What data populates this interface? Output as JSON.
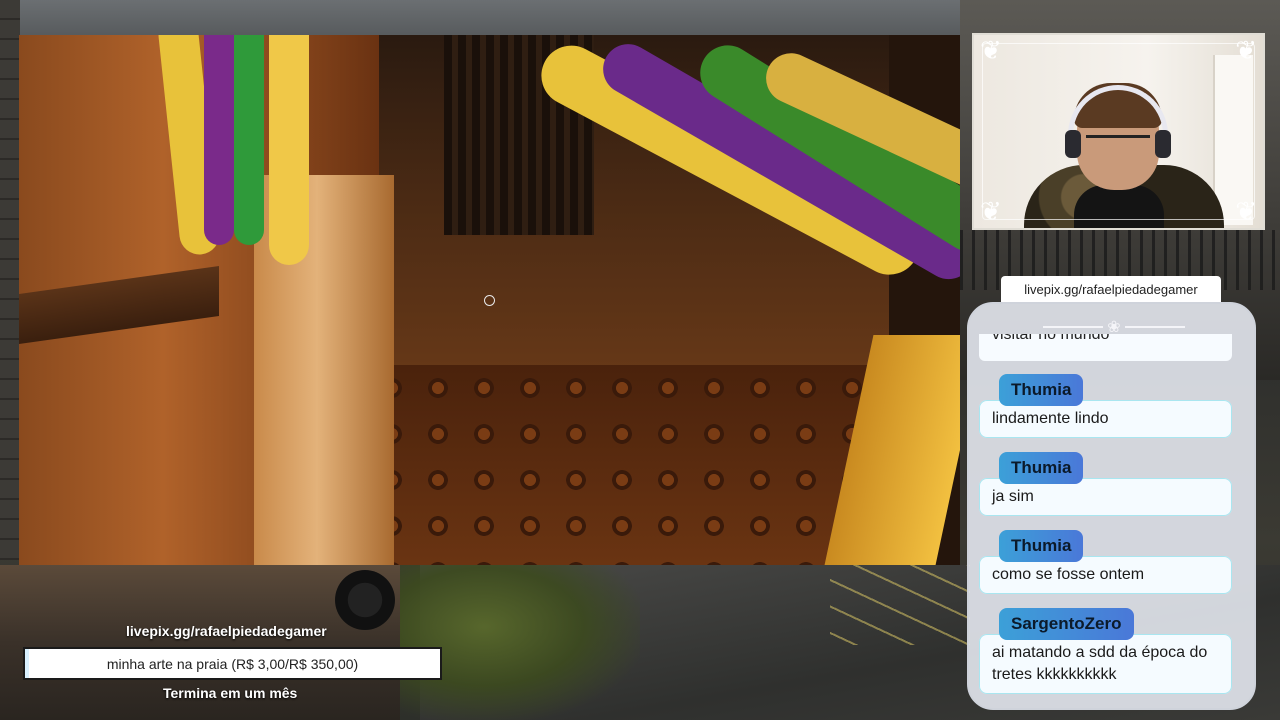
{
  "overlay": {
    "chat_source_url": "livepix.gg/rafaelpiedadegamer",
    "donation": {
      "url": "livepix.gg/rafaelpiedadegamer",
      "goal_label": "minha arte na praia (R$ 3,00/R$ 350,00)",
      "progress_fraction": 0.0086,
      "ends_text": "Termina em um mês"
    }
  },
  "chat": {
    "partial_message": "visitar no mundo",
    "messages": [
      {
        "user": "Thumia",
        "text": "lindamente lindo"
      },
      {
        "user": "Thumia",
        "text": "ja sim"
      },
      {
        "user": "Thumia",
        "text": "como se fosse ontem"
      },
      {
        "user": "SargentoZero",
        "text": "ai matando a sdd da época do tretes kkkkkkkkkk"
      }
    ]
  },
  "colors": {
    "username_gradient_start": "#3ca0d8",
    "username_gradient_end": "#4a78d8",
    "message_bg": "#f5fbff",
    "donation_border": "#1a1a1a"
  },
  "icons": {
    "crosshair": "crosshair-icon",
    "frame_ornament": "ornament-icon"
  }
}
